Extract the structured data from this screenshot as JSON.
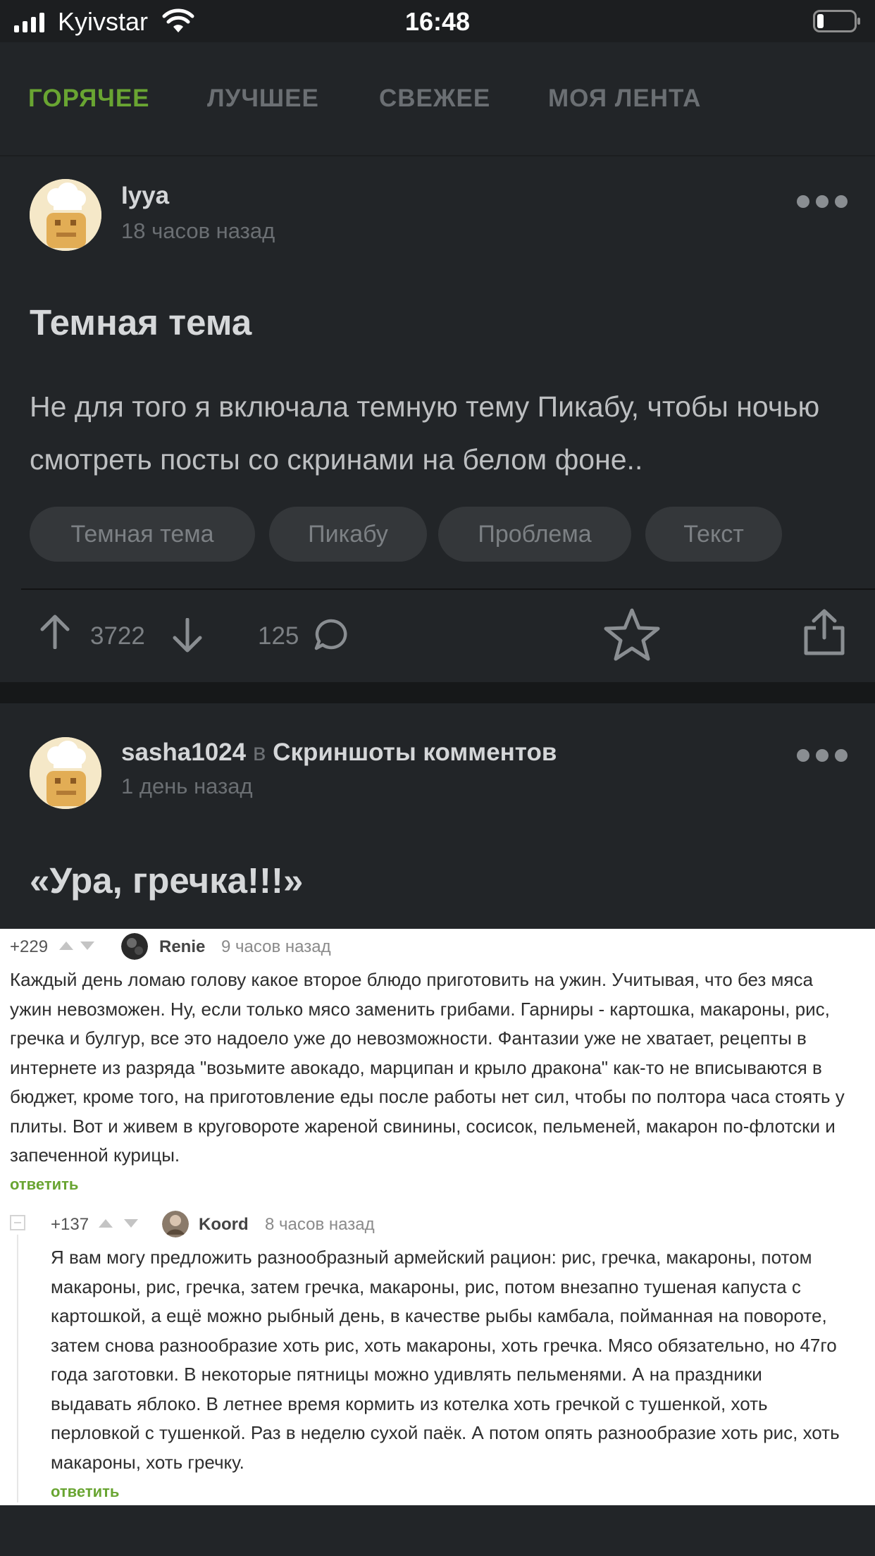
{
  "status_bar": {
    "carrier": "Kyivstar",
    "time": "16:48"
  },
  "tabs": [
    {
      "label": "ГОРЯЧЕЕ",
      "active": true
    },
    {
      "label": "ЛУЧШЕЕ",
      "active": false
    },
    {
      "label": "СВЕЖЕЕ",
      "active": false
    },
    {
      "label": "МОЯ ЛЕНТА",
      "active": false
    }
  ],
  "posts": [
    {
      "username": "Iyya",
      "time_ago": "18 часов назад",
      "title": "Темная тема",
      "text": "Не для того я включала темную тему Пикабу, чтобы ночью смотреть посты со скринами на белом фоне..",
      "tags": [
        "Темная тема",
        "Пикабу",
        "Проблема",
        "Текст"
      ],
      "rating": "3722",
      "comments": "125"
    },
    {
      "username": "sasha1024",
      "in_label": "в",
      "community": "Скриншоты комментов",
      "time_ago": "1 день назад",
      "title": "«Ура, гречка!!!»"
    }
  ],
  "screenshot_comments": [
    {
      "rating": "+229",
      "author": "Renie",
      "time_ago": "9 часов назад",
      "lines": [
        "Каждый день ломаю голову какое второе блюдо приготовить на ужин. Учитывая, что без мяса",
        "ужин невозможен. Ну, если только мясо заменить грибами. Гарниры - картошка, макароны, рис,",
        "гречка и булгур, все это надоело уже до невозможности. Фантазии уже не хватает, рецепты в",
        "интернете из разряда \"возьмите авокадо, марципан и крыло дракона\" как-то не вписываются в",
        "бюджет, кроме того, на приготовление еды после работы нет сил, чтобы по полтора часа стоять у",
        "плиты. Вот и живем в круговороте жареной свинины, сосисок, пельменей, макарон по-флотски и",
        "запеченной курицы."
      ],
      "reply": "ответить"
    },
    {
      "rating": "+137",
      "author": "Koord",
      "time_ago": "8 часов назад",
      "lines": [
        "Я вам могу предложить разнообразный армейский рацион: рис, гречка, макароны, потом",
        "макароны, рис, гречка, затем гречка, макароны, рис, потом внезапно тушеная капуста с",
        "картошкой, а ещё можно рыбный день, в качестве рыбы камбала, пойманная на повороте,",
        "затем снова разнообразие хоть рис, хоть макароны, хоть гречка. Мясо обязательно, но 47го",
        "года заготовки. В некоторые пятницы можно удивлять пельменями. А на праздники",
        "выдавать яблоко. В летнее время кормить из котелка хоть гречкой с тушенкой, хоть",
        "перловкой с тушенкой. Раз в неделю сухой паёк. А потом опять разнообразие хоть рис, хоть",
        "макароны, хоть гречку."
      ],
      "reply": "ответить"
    }
  ],
  "colors": {
    "accent": "#69a532",
    "background": "#222528",
    "muted": "#6b6f73"
  },
  "icons": [
    "signal-icon",
    "wifi-icon",
    "battery-icon",
    "more-icon",
    "upvote-icon",
    "downvote-icon",
    "comment-icon",
    "star-icon",
    "share-icon"
  ]
}
